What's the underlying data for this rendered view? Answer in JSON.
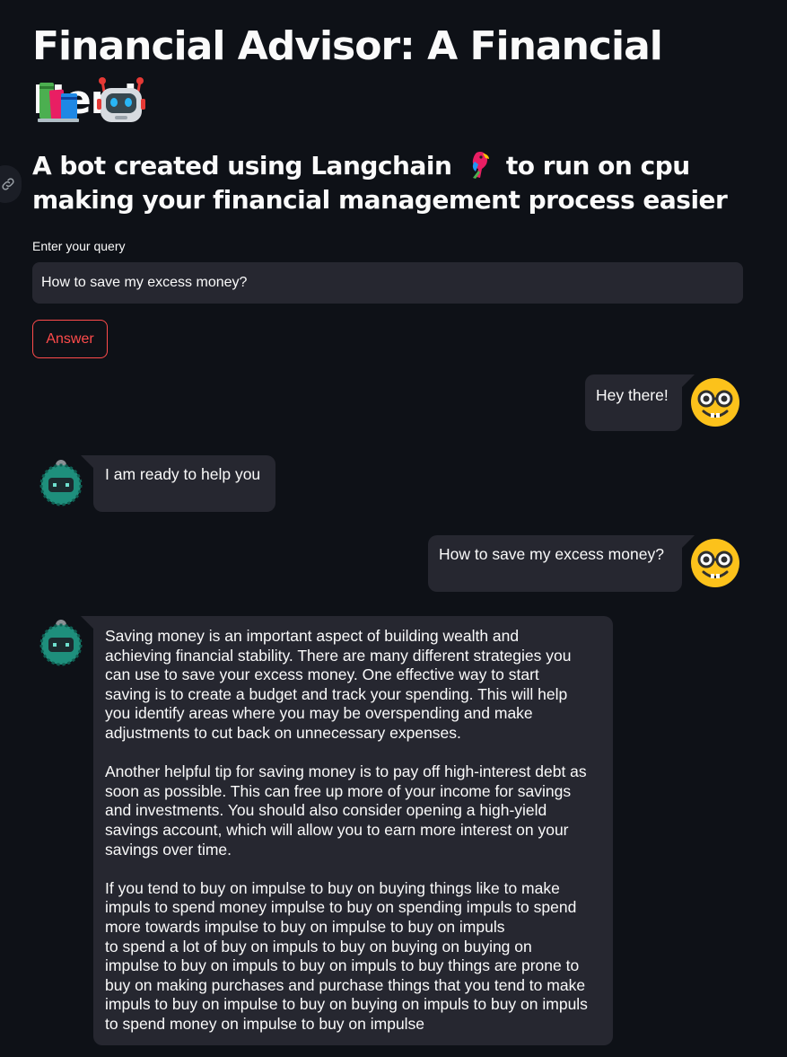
{
  "header": {
    "title": "Financial Advisor: A Financial Nerd",
    "title_emojis": [
      "books-icon",
      "robot-icon"
    ],
    "subtitle_before": "A bot created using Langchain",
    "subtitle_after": "to run on cpu making your financial management process easier",
    "subtitle_emoji": "parrot-icon"
  },
  "query": {
    "label": "Enter your query",
    "value": "How to save my excess money?"
  },
  "answer_button": {
    "label": "Answer"
  },
  "colors": {
    "background": "#0e1117",
    "bubble": "#262730",
    "accent": "#ff4b4b",
    "text": "#fafafa"
  },
  "chat": [
    {
      "role": "user",
      "avatar": "nerd-face-icon",
      "text": "Hey there!"
    },
    {
      "role": "bot",
      "avatar": "bot-avatar-icon",
      "text": "I am ready to help you"
    },
    {
      "role": "user",
      "avatar": "nerd-face-icon",
      "text": "How to save my excess money?"
    },
    {
      "role": "bot",
      "avatar": "bot-avatar-icon",
      "text": "Saving money is an important aspect of building wealth and\nachieving financial stability. There are many different strategies you\ncan use to save your excess money. One effective way to start\nsaving is to create a budget and track your spending. This will help\nyou identify areas where you may be overspending and make\nadjustments to cut back on unnecessary expenses.\n\nAnother helpful tip for saving money is to pay off high-interest debt as\nsoon as possible. This can free up more of your income for savings\nand investments. You should also consider opening a high-yield\nsavings account, which will allow you to earn more interest on your\nsavings over time.\n\nIf you tend to buy on impulse to buy on buying things like to make\nimpuls to spend money impulse to buy on spending impuls to spend\nmore towards impulse to buy on impulse to buy on impuls\nto spend a lot of buy on impuls to buy on buying on buying on\nimpulse to buy on impuls to buy on impuls to buy things are prone to\nbuy on making purchases and purchase things that you tend to make\nimpuls to buy on impulse to buy on buying on impuls to buy on impuls\nto spend money on impulse to buy on impulse"
    }
  ]
}
